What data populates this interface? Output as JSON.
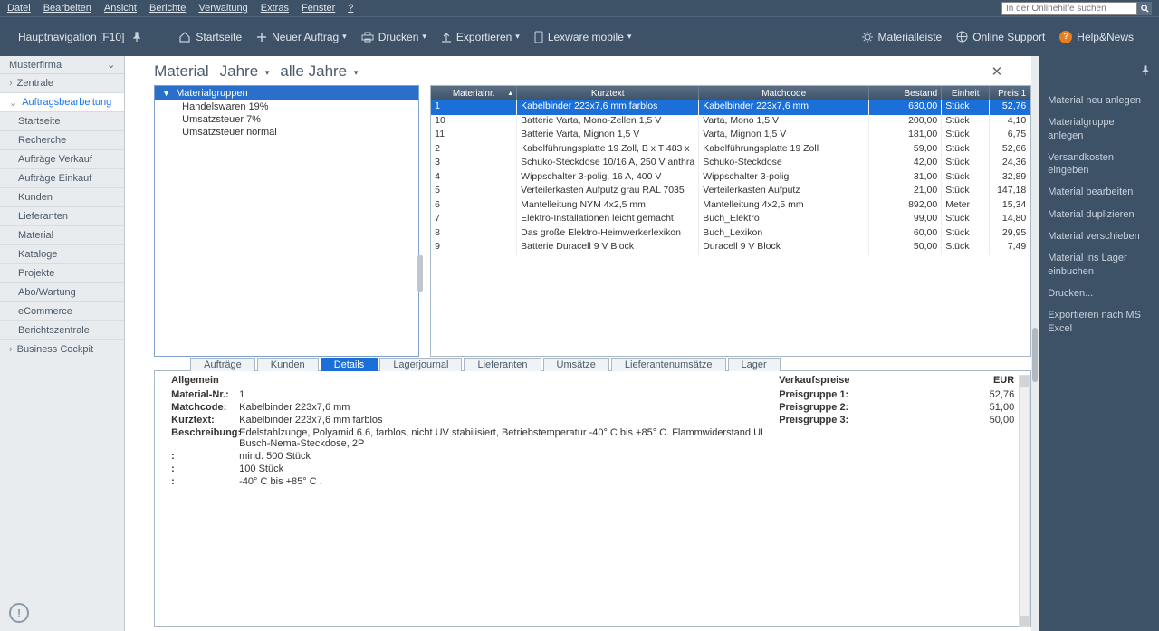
{
  "menubar": {
    "items": [
      "Datei",
      "Bearbeiten",
      "Ansicht",
      "Berichte",
      "Verwaltung",
      "Extras",
      "Fenster",
      "?"
    ],
    "search_placeholder": "In der Onlinehilfe suchen"
  },
  "toolbar": {
    "nav_label": "Hauptnavigation [F10]",
    "home": "Startseite",
    "neu": "Neuer Auftrag",
    "print": "Drucken",
    "export": "Exportieren",
    "mobile": "Lexware mobile",
    "materialleiste": "Materialleiste",
    "support": "Online Support",
    "helpnews": "Help&News"
  },
  "sidebar": {
    "company": "Musterfirma",
    "items": [
      {
        "label": "Zentrale",
        "type": "parent"
      },
      {
        "label": "Auftragsbearbeitung",
        "type": "parent",
        "expanded": true,
        "active": true
      },
      {
        "label": "Startseite"
      },
      {
        "label": "Recherche"
      },
      {
        "label": "Aufträge Verkauf"
      },
      {
        "label": "Aufträge Einkauf"
      },
      {
        "label": "Kunden"
      },
      {
        "label": "Lieferanten"
      },
      {
        "label": "Material"
      },
      {
        "label": "Kataloge"
      },
      {
        "label": "Projekte"
      },
      {
        "label": "Abo/Wartung"
      },
      {
        "label": "eCommerce"
      },
      {
        "label": "Berichtszentrale"
      },
      {
        "label": "Business Cockpit",
        "type": "parent"
      }
    ]
  },
  "header": {
    "title": "Material",
    "jahre": "Jahre",
    "alle": "alle Jahre"
  },
  "tree": {
    "root": "Materialgruppen",
    "items": [
      "Handelswaren 19%",
      "Umsatzsteuer 7%",
      "Umsatzsteuer normal"
    ]
  },
  "grid": {
    "cols": [
      "Materialnr.",
      "Kurztext",
      "Matchcode",
      "Bestand",
      "Einheit",
      "Preis 1"
    ],
    "rows": [
      {
        "nr": "1",
        "kt": "Kabelbinder 223x7,6 mm farblos",
        "mc": "Kabelbinder 223x7,6 mm",
        "be": "630,00",
        "ei": "Stück",
        "pr": "52,76",
        "sel": true
      },
      {
        "nr": "10",
        "kt": "Batterie Varta, Mono-Zellen 1,5 V",
        "mc": "Varta, Mono 1,5 V",
        "be": "200,00",
        "ei": "Stück",
        "pr": "4,10"
      },
      {
        "nr": "11",
        "kt": "Batterie Varta, Mignon 1,5 V",
        "mc": "Varta, Mignon 1,5 V",
        "be": "181,00",
        "ei": "Stück",
        "pr": "6,75"
      },
      {
        "nr": "2",
        "kt": "Kabelführungsplatte 19 Zoll,  B x T 483 x",
        "mc": "Kabelführungsplatte 19 Zoll",
        "be": "59,00",
        "ei": "Stück",
        "pr": "52,66"
      },
      {
        "nr": "3",
        "kt": "Schuko-Steckdose 10/16 A, 250 V anthra",
        "mc": "Schuko-Steckdose",
        "be": "42,00",
        "ei": "Stück",
        "pr": "24,36"
      },
      {
        "nr": "4",
        "kt": "Wippschalter 3-polig, 16 A, 400 V",
        "mc": "Wippschalter 3-polig",
        "be": "31,00",
        "ei": "Stück",
        "pr": "32,89"
      },
      {
        "nr": "5",
        "kt": "Verteilerkasten Aufputz grau RAL 7035",
        "mc": "Verteilerkasten Aufputz",
        "be": "21,00",
        "ei": "Stück",
        "pr": "147,18"
      },
      {
        "nr": "6",
        "kt": "Mantelleitung NYM 4x2,5 mm",
        "mc": "Mantelleitung 4x2,5 mm",
        "be": "892,00",
        "ei": "Meter",
        "pr": "15,34"
      },
      {
        "nr": "7",
        "kt": "Elektro-Installationen leicht gemacht",
        "mc": "Buch_Elektro",
        "be": "99,00",
        "ei": "Stück",
        "pr": "14,80"
      },
      {
        "nr": "8",
        "kt": "Das große Elektro-Heimwerkerlexikon",
        "mc": "Buch_Lexikon",
        "be": "60,00",
        "ei": "Stück",
        "pr": "29,95"
      },
      {
        "nr": "9",
        "kt": "Batterie Duracell 9 V Block",
        "mc": "Duracell 9 V Block",
        "be": "50,00",
        "ei": "Stück",
        "pr": "7,49"
      }
    ]
  },
  "tabs": [
    "Aufträge",
    "Kunden",
    "Details",
    "Lagerjournal",
    "Lieferanten",
    "Umsätze",
    "Lieferantenumsätze",
    "Lager"
  ],
  "active_tab": "Details",
  "detail": {
    "allg": "Allgemein",
    "vk": "Verkaufspreise",
    "eur": "EUR",
    "left": [
      {
        "l": "Material-Nr.:",
        "v": "1"
      },
      {
        "l": "Matchcode:",
        "v": "Kabelbinder 223x7,6 mm"
      },
      {
        "l": "Kurztext:",
        "v": "Kabelbinder 223x7,6 mm farblos"
      },
      {
        "l": "Beschreibung:",
        "v": "Edelstahlzunge, Polyamid 6.6, farblos, nicht UV stabilisiert, Betriebstemperatur -40° C bis +85° C. Flammwiderstand UL Busch-Nema-Steckdose, 2P"
      },
      {
        "l": ":",
        "v": "mind. 500 Stück"
      },
      {
        "l": ":",
        "v": "100 Stück"
      },
      {
        "l": ":",
        "v": "-40° C bis +85° C ."
      }
    ],
    "right": [
      {
        "l": "Preisgruppe 1:",
        "v": "52,76"
      },
      {
        "l": "Preisgruppe 2:",
        "v": "51,00"
      },
      {
        "l": "Preisgruppe 3:",
        "v": "50,00"
      }
    ]
  },
  "actions": [
    "Material neu anlegen",
    "Materialgruppe anlegen",
    "Versandkosten eingeben",
    "Material bearbeiten",
    "Material duplizieren",
    "Material verschieben",
    "Material ins Lager einbuchen",
    "Drucken...",
    "Exportieren nach MS Excel"
  ]
}
